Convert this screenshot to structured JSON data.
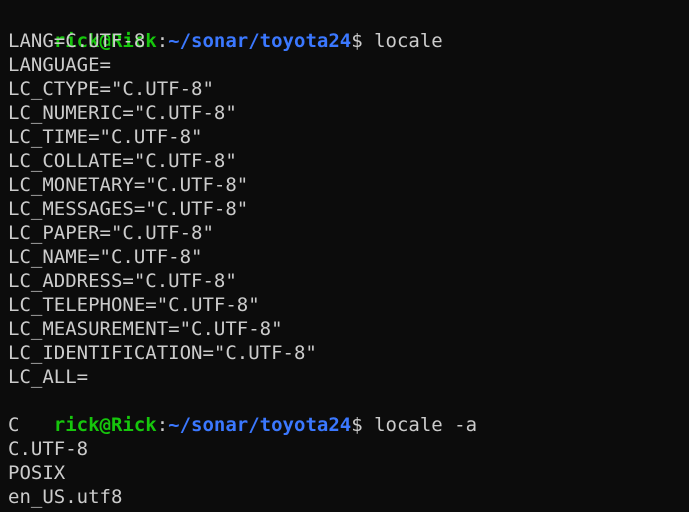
{
  "prompt": {
    "user_host": "rick@Rick",
    "colon": ":",
    "path": "~/sonar/toyota24",
    "dollar": "$"
  },
  "commands": {
    "first": " locale",
    "second": " locale -a"
  },
  "locale_output": [
    "LANG=C.UTF-8",
    "LANGUAGE=",
    "LC_CTYPE=\"C.UTF-8\"",
    "LC_NUMERIC=\"C.UTF-8\"",
    "LC_TIME=\"C.UTF-8\"",
    "LC_COLLATE=\"C.UTF-8\"",
    "LC_MONETARY=\"C.UTF-8\"",
    "LC_MESSAGES=\"C.UTF-8\"",
    "LC_PAPER=\"C.UTF-8\"",
    "LC_NAME=\"C.UTF-8\"",
    "LC_ADDRESS=\"C.UTF-8\"",
    "LC_TELEPHONE=\"C.UTF-8\"",
    "LC_MEASUREMENT=\"C.UTF-8\"",
    "LC_IDENTIFICATION=\"C.UTF-8\"",
    "LC_ALL="
  ],
  "locale_a_output": [
    "C",
    "C.UTF-8",
    "POSIX",
    "en_US.utf8"
  ]
}
